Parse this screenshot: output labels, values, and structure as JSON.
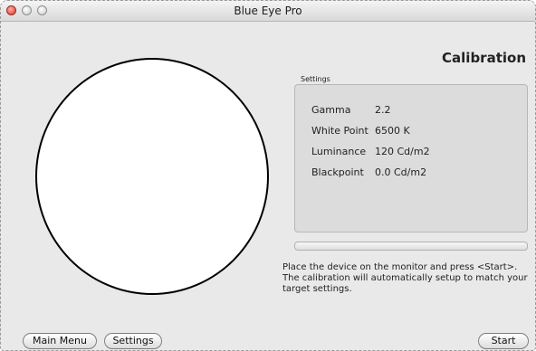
{
  "window": {
    "title": "Blue Eye Pro"
  },
  "screen": {
    "title": "Calibration"
  },
  "settings": {
    "caption": "Settings",
    "rows": [
      {
        "label": "Gamma",
        "value": "2.2"
      },
      {
        "label": "White Point",
        "value": "6500 K"
      },
      {
        "label": "Luminance",
        "value": "120 Cd/m2"
      },
      {
        "label": "Blackpoint",
        "value": "0.0 Cd/m2"
      }
    ]
  },
  "progress": {
    "value": 0
  },
  "instructions": "Place the device on the monitor and press <Start>. The calibration will automatically setup to match your target settings.",
  "buttons": {
    "main_menu": "Main Menu",
    "settings": "Settings",
    "start": "Start"
  }
}
